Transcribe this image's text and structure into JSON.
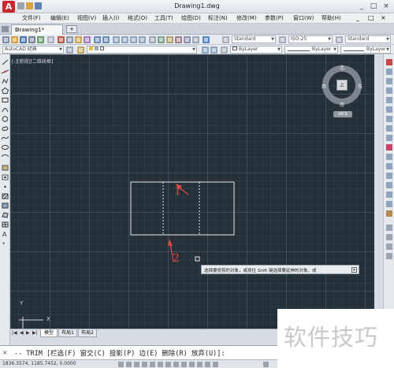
{
  "window": {
    "title": "Drawing1.dwg",
    "logo_letter": "A"
  },
  "menu": {
    "items": [
      "文件(F)",
      "编辑(E)",
      "视图(V)",
      "插入(I)",
      "格式(O)",
      "工具(T)",
      "绘图(D)",
      "标注(N)",
      "修改(M)",
      "参数(P)",
      "窗口(W)",
      "帮助(H)"
    ],
    "doc_controls": [
      "_",
      "□",
      "×"
    ]
  },
  "tabs": {
    "doc_tab": "Drawing1*",
    "close": "×",
    "new_tab": "+"
  },
  "toolbar": {
    "text_style": "Standard",
    "dim_style": "ISO-25",
    "table_style": "Standard",
    "workspace": "AutoCAD 经典",
    "layer_color": "ByLayer",
    "linetype": "ByLayer",
    "lineweight": "ByLayer"
  },
  "viewport": {
    "label": "[-][俯视][二维线框]"
  },
  "viewcube": {
    "face": "上",
    "north": "北",
    "south": "南",
    "west": "西",
    "east": "东",
    "wcs": "WCS"
  },
  "annotations": {
    "label_1": "1",
    "label_2": "2"
  },
  "tooltip": {
    "text": "选择要修剪的对象，或按住 Shift 键选择要延伸的对象，或"
  },
  "ucs": {
    "x": "X",
    "y": "Y"
  },
  "layout_tabs": {
    "nav": [
      "|◀",
      "◀",
      "▶",
      "▶|"
    ],
    "model": "模型",
    "layout1": "布局1",
    "layout2": "布局2"
  },
  "command": {
    "close": "×",
    "text": "-- TRIM [栏选(F) 窗交(C) 投影(P) 边(E) 删除(R) 放弃(U)]:"
  },
  "status": {
    "coords": "1836.3574, 1185.7452, 0.0000"
  },
  "watermark": {
    "text": "软件技巧"
  },
  "colors": {
    "canvas": "#263039",
    "drawing_lines": "#e6e6e6",
    "annotation": "#d94848",
    "logo": "#c8282d"
  }
}
